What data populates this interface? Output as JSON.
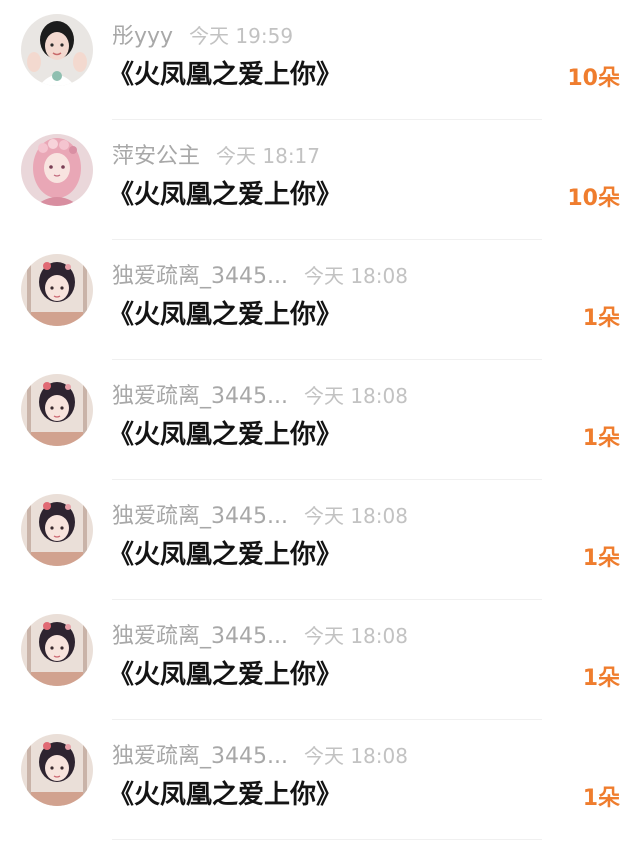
{
  "colors": {
    "background": "#ffffff",
    "username": "#a8a8a8",
    "timestamp": "#c2c2c2",
    "title": "#141414",
    "flower_count": "#ef7d2e",
    "divider": "#f0f0f0"
  },
  "entries": [
    {
      "username": "彤yyy",
      "time": "今天 19:59",
      "title": "《火凤凰之爱上你》",
      "count": "10朵",
      "avatar_icon": "girl-waving-avatar"
    },
    {
      "username": "萍安公主",
      "time": "今天 18:17",
      "title": "《火凤凰之爱上你》",
      "count": "10朵",
      "avatar_icon": "pink-hair-anime-avatar"
    },
    {
      "username": "独爱疏离_3445...",
      "time": "今天 18:08",
      "title": "《火凤凰之爱上你》",
      "count": "1朵",
      "avatar_icon": "anime-girl-avatar"
    },
    {
      "username": "独爱疏离_3445...",
      "time": "今天 18:08",
      "title": "《火凤凰之爱上你》",
      "count": "1朵",
      "avatar_icon": "anime-girl-avatar"
    },
    {
      "username": "独爱疏离_3445...",
      "time": "今天 18:08",
      "title": "《火凤凰之爱上你》",
      "count": "1朵",
      "avatar_icon": "anime-girl-avatar"
    },
    {
      "username": "独爱疏离_3445...",
      "time": "今天 18:08",
      "title": "《火凤凰之爱上你》",
      "count": "1朵",
      "avatar_icon": "anime-girl-avatar"
    },
    {
      "username": "独爱疏离_3445...",
      "time": "今天 18:08",
      "title": "《火凤凰之爱上你》",
      "count": "1朵",
      "avatar_icon": "anime-girl-avatar"
    }
  ]
}
